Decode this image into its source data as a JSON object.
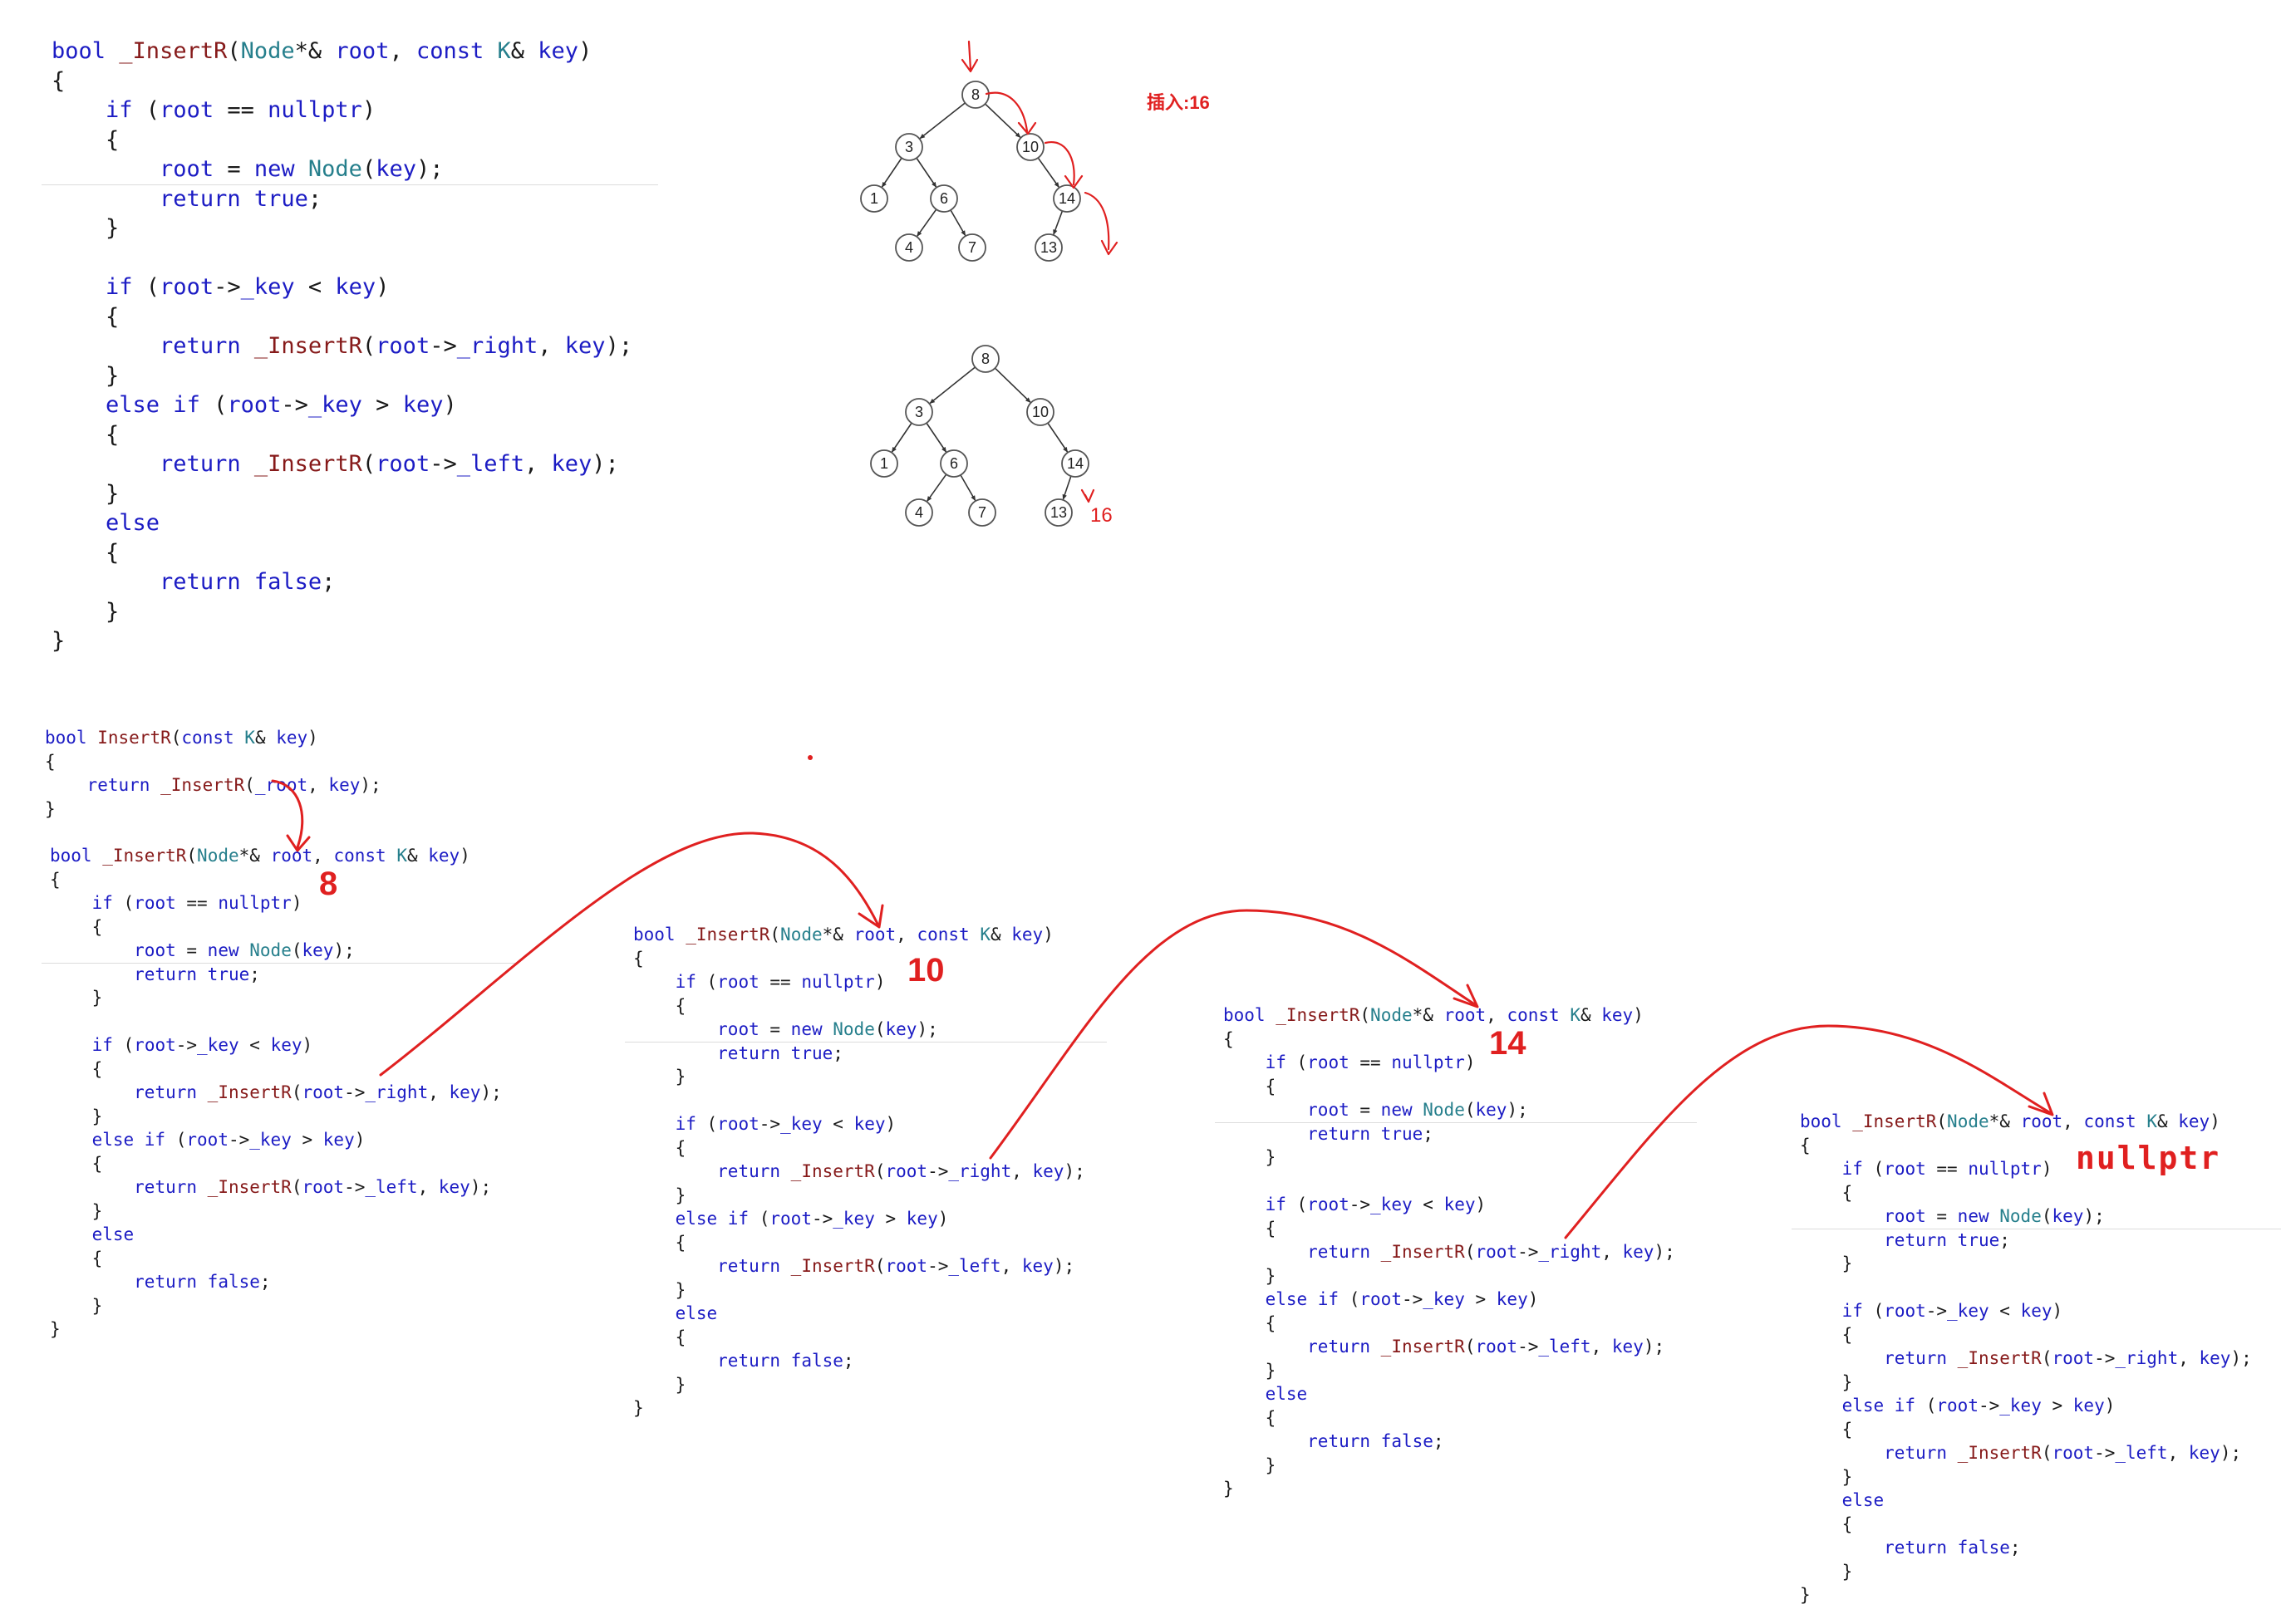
{
  "main_code": [
    [
      [
        "kw",
        "bool"
      ],
      [
        "t",
        " "
      ],
      [
        "fn",
        "_InsertR"
      ],
      [
        "t",
        "("
      ],
      [
        "ty",
        "Node"
      ],
      [
        "t",
        "*& "
      ],
      [
        "kw",
        "root"
      ],
      [
        "t",
        ", "
      ],
      [
        "kw",
        "const"
      ],
      [
        "t",
        " "
      ],
      [
        "ty",
        "K"
      ],
      [
        "t",
        "& "
      ],
      [
        "kw",
        "key"
      ],
      [
        "t",
        ")"
      ]
    ],
    [
      [
        "t",
        "{"
      ]
    ],
    [
      [
        "t",
        "    "
      ],
      [
        "kw",
        "if"
      ],
      [
        "t",
        " ("
      ],
      [
        "kw",
        "root"
      ],
      [
        "t",
        " == "
      ],
      [
        "kw",
        "nullptr"
      ],
      [
        "t",
        ")"
      ]
    ],
    [
      [
        "t",
        "    {"
      ]
    ],
    [
      [
        "t",
        "        "
      ],
      [
        "kw",
        "root"
      ],
      [
        "t",
        " = "
      ],
      [
        "kw",
        "new"
      ],
      [
        "t",
        " "
      ],
      [
        "ty",
        "Node"
      ],
      [
        "t",
        "("
      ],
      [
        "kw",
        "key"
      ],
      [
        "t",
        ");"
      ]
    ],
    [
      [
        "t",
        "        "
      ],
      [
        "kw",
        "return"
      ],
      [
        "t",
        " "
      ],
      [
        "kw",
        "true"
      ],
      [
        "t",
        ";"
      ]
    ],
    [
      [
        "t",
        "    }"
      ]
    ],
    [
      [
        "t",
        ""
      ]
    ],
    [
      [
        "t",
        "    "
      ],
      [
        "kw",
        "if"
      ],
      [
        "t",
        " ("
      ],
      [
        "kw",
        "root"
      ],
      [
        "t",
        "->"
      ],
      [
        "kw",
        "_key"
      ],
      [
        "t",
        " < "
      ],
      [
        "kw",
        "key"
      ],
      [
        "t",
        ")"
      ]
    ],
    [
      [
        "t",
        "    {"
      ]
    ],
    [
      [
        "t",
        "        "
      ],
      [
        "kw",
        "return"
      ],
      [
        "t",
        " "
      ],
      [
        "fn",
        "_InsertR"
      ],
      [
        "t",
        "("
      ],
      [
        "kw",
        "root"
      ],
      [
        "t",
        "->"
      ],
      [
        "kw",
        "_right"
      ],
      [
        "t",
        ", "
      ],
      [
        "kw",
        "key"
      ],
      [
        "t",
        ");"
      ]
    ],
    [
      [
        "t",
        "    }"
      ]
    ],
    [
      [
        "t",
        "    "
      ],
      [
        "kw",
        "else if"
      ],
      [
        "t",
        " ("
      ],
      [
        "kw",
        "root"
      ],
      [
        "t",
        "->"
      ],
      [
        "kw",
        "_key"
      ],
      [
        "t",
        " > "
      ],
      [
        "kw",
        "key"
      ],
      [
        "t",
        ")"
      ]
    ],
    [
      [
        "t",
        "    {"
      ]
    ],
    [
      [
        "t",
        "        "
      ],
      [
        "kw",
        "return"
      ],
      [
        "t",
        " "
      ],
      [
        "fn",
        "_InsertR"
      ],
      [
        "t",
        "("
      ],
      [
        "kw",
        "root"
      ],
      [
        "t",
        "->"
      ],
      [
        "kw",
        "_left"
      ],
      [
        "t",
        ", "
      ],
      [
        "kw",
        "key"
      ],
      [
        "t",
        ");"
      ]
    ],
    [
      [
        "t",
        "    }"
      ]
    ],
    [
      [
        "t",
        "    "
      ],
      [
        "kw",
        "else"
      ]
    ],
    [
      [
        "t",
        "    {"
      ]
    ],
    [
      [
        "t",
        "        "
      ],
      [
        "kw",
        "return"
      ],
      [
        "t",
        " "
      ],
      [
        "kw",
        "false"
      ],
      [
        "t",
        ";"
      ]
    ],
    [
      [
        "t",
        "    }"
      ]
    ],
    [
      [
        "t",
        "}"
      ]
    ]
  ],
  "wrapper_code": [
    [
      [
        "kw",
        "bool"
      ],
      [
        "t",
        " "
      ],
      [
        "fn",
        "InsertR"
      ],
      [
        "t",
        "("
      ],
      [
        "kw",
        "const"
      ],
      [
        "t",
        " "
      ],
      [
        "ty",
        "K"
      ],
      [
        "t",
        "& "
      ],
      [
        "kw",
        "key"
      ],
      [
        "t",
        ")"
      ]
    ],
    [
      [
        "t",
        "{"
      ]
    ],
    [
      [
        "t",
        "    "
      ],
      [
        "kw",
        "return"
      ],
      [
        "t",
        " "
      ],
      [
        "fn",
        "_InsertR"
      ],
      [
        "t",
        "("
      ],
      [
        "kw",
        "_root"
      ],
      [
        "t",
        ", "
      ],
      [
        "kw",
        "key"
      ],
      [
        "t",
        ");"
      ]
    ],
    [
      [
        "t",
        "}"
      ]
    ]
  ],
  "call_frame_labels": [
    "8",
    "10",
    "14",
    "nullptr"
  ],
  "tree_labels": {
    "insert_note": "插入:16",
    "new_node": "16"
  },
  "tree_before": [
    {
      "key": "8"
    },
    {
      "key": "3"
    },
    {
      "key": "10"
    },
    {
      "key": "1"
    },
    {
      "key": "6"
    },
    {
      "key": "14"
    },
    {
      "key": "4"
    },
    {
      "key": "7"
    },
    {
      "key": "13"
    }
  ],
  "tree_after": [
    {
      "key": "8"
    },
    {
      "key": "3"
    },
    {
      "key": "10"
    },
    {
      "key": "1"
    },
    {
      "key": "6"
    },
    {
      "key": "14"
    },
    {
      "key": "4"
    },
    {
      "key": "7"
    },
    {
      "key": "13"
    }
  ],
  "colors": {
    "keyword": "#1c1cc4",
    "type": "#267f8c",
    "function": "#861a1a",
    "annotation": "#e02020",
    "node_stroke": "#555555"
  }
}
